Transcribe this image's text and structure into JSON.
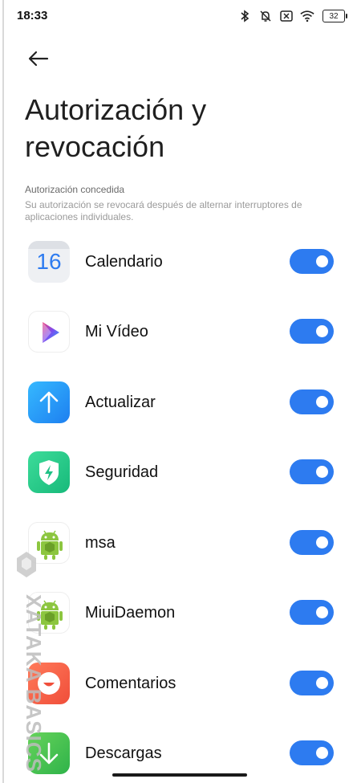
{
  "status_bar": {
    "time": "18:33",
    "battery": "32"
  },
  "header": {
    "title": "Autorización y revocación"
  },
  "section": {
    "label": "Autorización concedida",
    "description": "Su autorización se revocará después de alternar interruptores de aplicaciones individuales."
  },
  "apps": [
    {
      "name": "Calendario",
      "icon": "calendar-icon",
      "icon_text": "16",
      "enabled": true
    },
    {
      "name": "Mi Vídeo",
      "icon": "play-icon",
      "enabled": true
    },
    {
      "name": "Actualizar",
      "icon": "update-icon",
      "enabled": true
    },
    {
      "name": "Seguridad",
      "icon": "security-shield-icon",
      "enabled": true
    },
    {
      "name": "msa",
      "icon": "android-icon",
      "enabled": true
    },
    {
      "name": "MiuiDaemon",
      "icon": "android-icon",
      "enabled": true
    },
    {
      "name": "Comentarios",
      "icon": "feedback-icon",
      "enabled": true
    },
    {
      "name": "Descargas",
      "icon": "download-icon",
      "enabled": true
    }
  ],
  "watermark": {
    "text": "XATAKA BASICS"
  },
  "colors": {
    "toggle_on": "#2d7bf0",
    "background": "#ffffff"
  }
}
